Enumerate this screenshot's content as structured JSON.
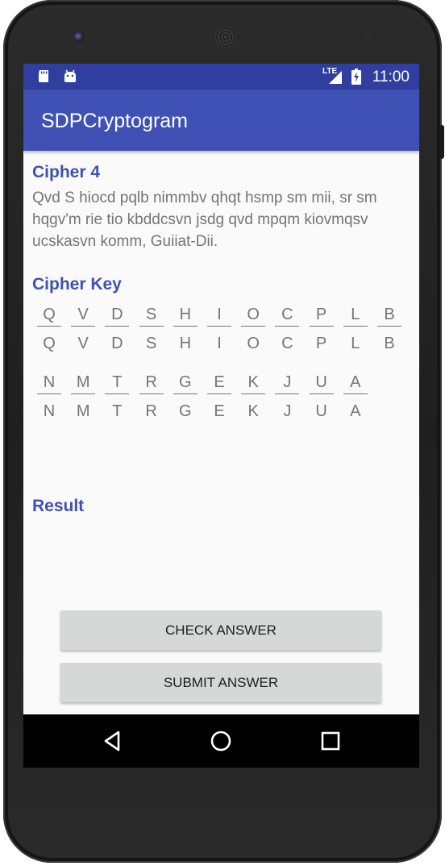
{
  "status_bar": {
    "time": "11:00",
    "network_label": "LTE",
    "left_icons": [
      "sd-card-icon",
      "android-icon"
    ],
    "right_icons": [
      "signal-icon",
      "battery-charging-icon"
    ]
  },
  "app_bar": {
    "title": "SDPCryptogram"
  },
  "cipher": {
    "heading": "Cipher 4",
    "text": "Qvd S hiocd pqlb nimmbv qhqt hsmp sm mii, sr sm hqgv'm rie tio kbddcsvn jsdg qvd mpqm kiovmqsv ucskasvn komm, Guiiat-Dii."
  },
  "cipher_key": {
    "heading": "Cipher Key",
    "rows": [
      [
        {
          "top": "Q",
          "bottom": "Q"
        },
        {
          "top": "V",
          "bottom": "V"
        },
        {
          "top": "D",
          "bottom": "D"
        },
        {
          "top": "S",
          "bottom": "S"
        },
        {
          "top": "H",
          "bottom": "H"
        },
        {
          "top": "I",
          "bottom": "I"
        },
        {
          "top": "O",
          "bottom": "O"
        },
        {
          "top": "C",
          "bottom": "C"
        },
        {
          "top": "P",
          "bottom": "P"
        },
        {
          "top": "L",
          "bottom": "L"
        },
        {
          "top": "B",
          "bottom": "B"
        }
      ],
      [
        {
          "top": "N",
          "bottom": "N"
        },
        {
          "top": "M",
          "bottom": "M"
        },
        {
          "top": "T",
          "bottom": "T"
        },
        {
          "top": "R",
          "bottom": "R"
        },
        {
          "top": "G",
          "bottom": "G"
        },
        {
          "top": "E",
          "bottom": "E"
        },
        {
          "top": "K",
          "bottom": "K"
        },
        {
          "top": "J",
          "bottom": "J"
        },
        {
          "top": "U",
          "bottom": "U"
        },
        {
          "top": "A",
          "bottom": "A"
        }
      ]
    ]
  },
  "result": {
    "heading": "Result",
    "text": ""
  },
  "buttons": {
    "check": "CHECK ANSWER",
    "submit": "SUBMIT ANSWER"
  },
  "nav_bar": {
    "icons": [
      "back-icon",
      "home-icon",
      "recents-icon"
    ]
  },
  "colors": {
    "primary": "#3f51b5",
    "primary_dark": "#303f9f",
    "text_secondary": "#757575",
    "button_bg": "#d6d7d7",
    "screen_bg": "#fafafa"
  }
}
